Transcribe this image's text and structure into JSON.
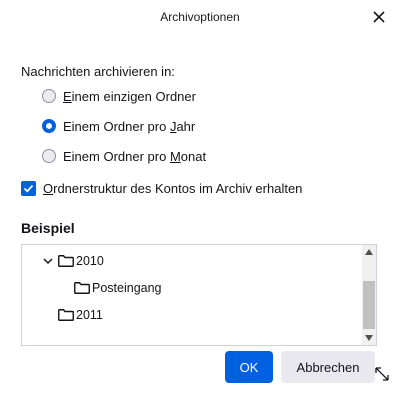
{
  "window": {
    "title": "Archivoptionen",
    "close_icon": "close-icon"
  },
  "archive": {
    "prompt": "Nachrichten archivieren in:",
    "options": [
      {
        "pre": "",
        "key": "E",
        "post": "inem einzigen Ordner",
        "selected": false
      },
      {
        "pre": "Einem Ordner pro ",
        "key": "J",
        "post": "ahr",
        "selected": true
      },
      {
        "pre": "Einem Ordner pro ",
        "key": "M",
        "post": "onat",
        "selected": false
      }
    ],
    "keep_structure": {
      "pre": "",
      "key": "O",
      "post": "rdnerstruktur des Kontos im Archiv erhalten",
      "checked": true
    }
  },
  "example": {
    "heading": "Beispiel",
    "tree": [
      {
        "label": "2010",
        "expanded": true,
        "level": 0
      },
      {
        "label": "Posteingang",
        "level": 1
      },
      {
        "label": "2011",
        "level": 0
      }
    ]
  },
  "buttons": {
    "ok": "OK",
    "cancel": "Abbrechen"
  },
  "colors": {
    "accent": "#0061e0",
    "cancel_bg": "#e8e8ee"
  }
}
